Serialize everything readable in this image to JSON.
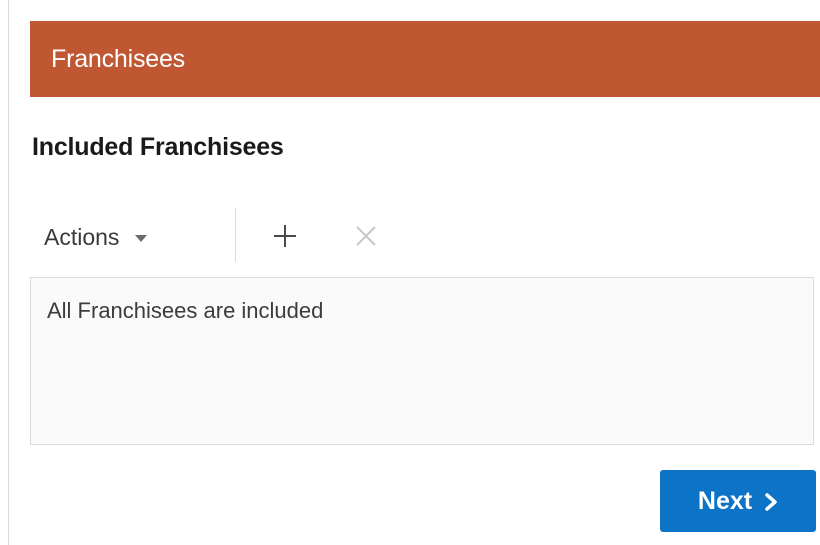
{
  "panel": {
    "title": "Franchisees"
  },
  "section": {
    "heading": "Included Franchisees"
  },
  "toolbar": {
    "actions_label": "Actions",
    "actions_icon": "caret-down-icon",
    "add_icon": "plus-icon",
    "remove_icon": "close-icon",
    "remove_disabled": true
  },
  "content": {
    "empty_message": "All Franchisees are included"
  },
  "footer": {
    "next_label": "Next",
    "next_icon": "chevron-right-icon"
  },
  "colors": {
    "header_bg": "#c05733",
    "primary_button": "#0c73c7",
    "disabled_icon": "#c8c8c8"
  }
}
